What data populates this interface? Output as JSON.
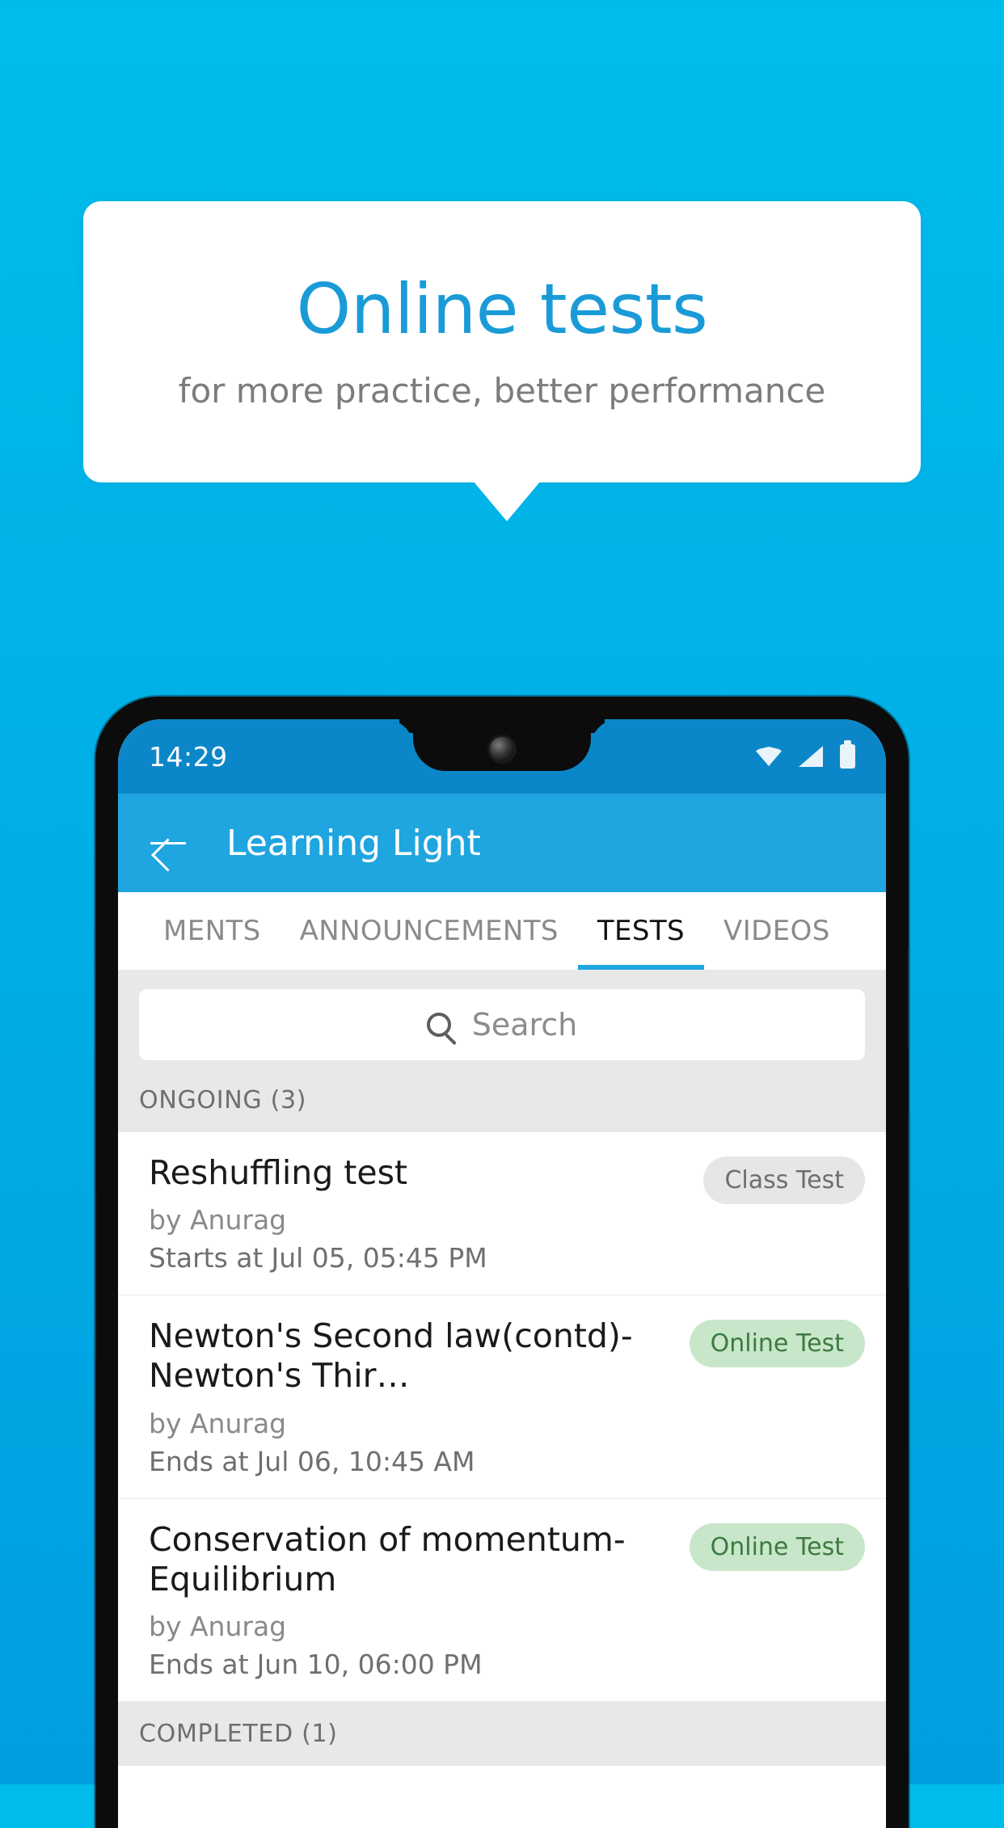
{
  "promo": {
    "title": "Online tests",
    "subtitle": "for more practice, better performance",
    "accent_color": "#1A9BD7",
    "background_color": "#00B5E8"
  },
  "phone": {
    "statusbar": {
      "time": "14:29",
      "icons": [
        "wifi-icon",
        "signal-icon",
        "battery-icon"
      ]
    },
    "appbar": {
      "back_icon": "back-arrow-icon",
      "title": "Learning Light",
      "color": "#1FA5DF"
    },
    "tabs": [
      {
        "label": "MENTS",
        "active": false
      },
      {
        "label": "ANNOUNCEMENTS",
        "active": false
      },
      {
        "label": "TESTS",
        "active": true
      },
      {
        "label": "VIDEOS",
        "active": false
      }
    ],
    "search": {
      "icon": "search-icon",
      "placeholder": "Search",
      "value": ""
    },
    "sections": [
      {
        "header": "ONGOING (3)"
      },
      {
        "header": "COMPLETED (1)"
      }
    ],
    "tests": [
      {
        "title": "Reshuffling test",
        "author": "by Anurag",
        "time_label": "Starts at",
        "time_value": "Jul 05, 05:45 PM",
        "badge": "Class Test",
        "badge_type": "class-test"
      },
      {
        "title": "Newton's Second law(contd)-Newton's Thir…",
        "author": "by Anurag",
        "time_label": "Ends at",
        "time_value": "Jul 06, 10:45 AM",
        "badge": "Online Test",
        "badge_type": "online-test"
      },
      {
        "title": "Conservation of momentum-Equilibrium",
        "author": "by Anurag",
        "time_label": "Ends at",
        "time_value": "Jun 10, 06:00 PM",
        "badge": "Online Test",
        "badge_type": "online-test"
      }
    ]
  }
}
